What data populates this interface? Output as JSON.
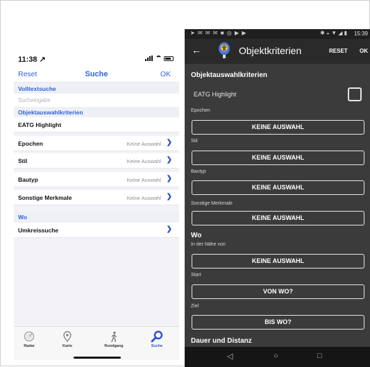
{
  "ios": {
    "status": {
      "time": "11:38 ↗"
    },
    "nav": {
      "reset": "Reset",
      "title": "Suche",
      "ok": "OK"
    },
    "sections": {
      "volltext": "Volltextsuche",
      "objekt": "Objektauswahlkriterien",
      "wo": "Wo"
    },
    "search": {
      "placeholder": "Sucheingabe",
      "value": ""
    },
    "rows": {
      "eatg": {
        "label": "EATG Highlight"
      },
      "epochen": {
        "label": "Epochen",
        "value": "Keine Auswahl"
      },
      "stil": {
        "label": "Stil",
        "value": "Keine Auswahl"
      },
      "bautyp": {
        "label": "Bautyp",
        "value": "Keine Auswahl"
      },
      "sonstige": {
        "label": "Sonstige Merkmale",
        "value": "Keine Auswahl"
      },
      "umkreis": {
        "label": "Umkreissuche"
      }
    },
    "tabs": {
      "radar": "Radar",
      "karte": "Karte",
      "rundgang": "Rundgang",
      "suche": "Suche"
    },
    "colors": {
      "accent": "#2f63d8",
      "section_bg": "#eef0f6"
    }
  },
  "android": {
    "status": {
      "time": "15:39"
    },
    "appbar": {
      "title": "Objektkriterien",
      "reset": "RESET",
      "ok": "OK"
    },
    "sections": {
      "objekt": "Objektauswahlkriterien",
      "wo": "Wo",
      "dauer": "Dauer und Distanz"
    },
    "eatg": {
      "label": "EATG Highlight",
      "checked": false
    },
    "fields": {
      "epochen": {
        "label": "Epochen",
        "button": "KEINE AUSWAHL"
      },
      "stil": {
        "label": "Stil",
        "button": "KEINE AUSWAHL"
      },
      "bautyp": {
        "label": "Bautyp",
        "button": "KEINE AUSWAHL"
      },
      "sonstige": {
        "label": "Sonstige Merkmale",
        "button": "KEINE AUSWAHL"
      },
      "naehe": {
        "label": "In der Nähe von",
        "button": "KEINE AUSWAHL"
      },
      "start": {
        "label": "Start",
        "button": "VON WO?"
      },
      "ziel": {
        "label": "Ziel",
        "button": "BIS WO?"
      }
    },
    "colors": {
      "background": "#3b3b3b",
      "appbar": "#2a2a2a"
    }
  }
}
